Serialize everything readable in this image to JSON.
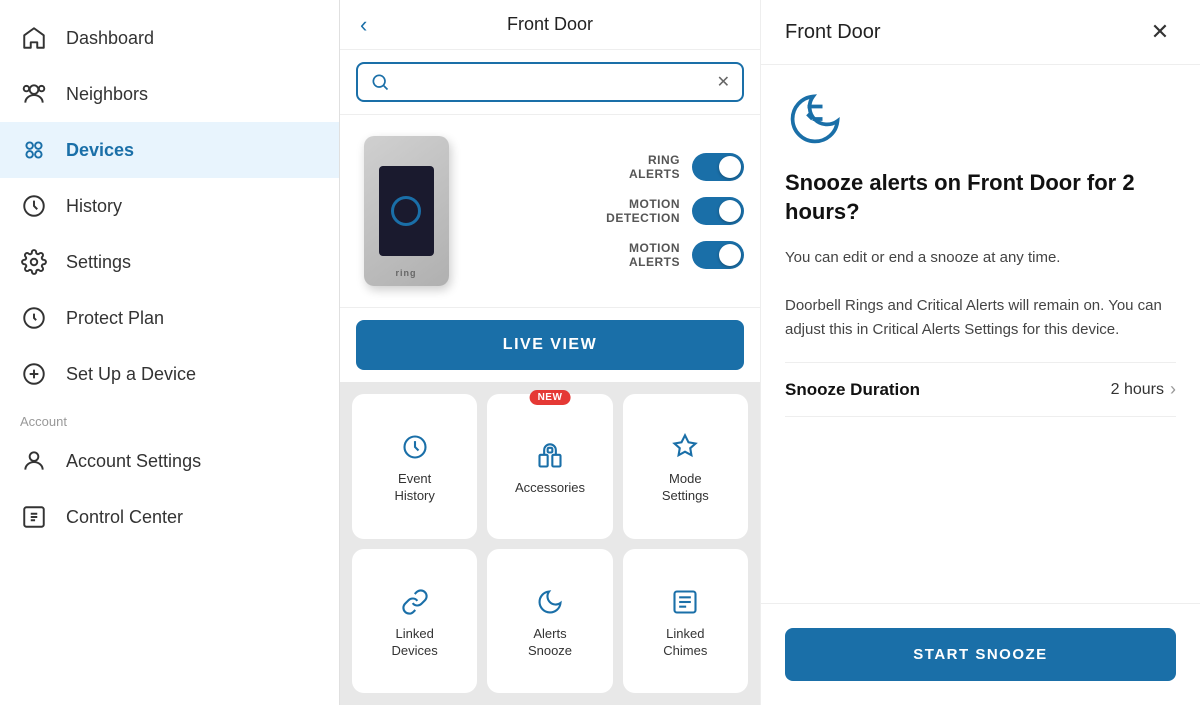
{
  "sidebar": {
    "items": [
      {
        "id": "dashboard",
        "label": "Dashboard",
        "icon": "home"
      },
      {
        "id": "neighbors",
        "label": "Neighbors",
        "icon": "neighbors"
      },
      {
        "id": "devices",
        "label": "Devices",
        "icon": "devices",
        "active": true
      },
      {
        "id": "history",
        "label": "History",
        "icon": "history"
      },
      {
        "id": "settings",
        "label": "Settings",
        "icon": "settings"
      },
      {
        "id": "protect-plan",
        "label": "Protect Plan",
        "icon": "shield"
      },
      {
        "id": "setup",
        "label": "Set Up a Device",
        "icon": "plus"
      }
    ],
    "account_label": "Account",
    "account_items": [
      {
        "id": "account-settings",
        "label": "Account Settings",
        "icon": "user"
      },
      {
        "id": "control-center",
        "label": "Control Center",
        "icon": "control"
      }
    ]
  },
  "device_panel": {
    "title": "Front Door",
    "search_placeholder": "",
    "toggles": [
      {
        "id": "ring-alerts",
        "label": "RING\nALERTS",
        "enabled": true
      },
      {
        "id": "motion-detection",
        "label": "MOTION\nDETECTION",
        "enabled": true
      },
      {
        "id": "motion-alerts",
        "label": "MOTION\nALERTS",
        "enabled": true
      }
    ],
    "live_view_label": "LIVE VIEW",
    "grid_items": [
      {
        "id": "event-history",
        "label": "Event\nHistory",
        "icon": "clock",
        "new": false
      },
      {
        "id": "accessories",
        "label": "Accessories",
        "icon": "accessories",
        "new": true,
        "new_label": "NEW"
      },
      {
        "id": "mode-settings",
        "label": "Mode\nSettings",
        "icon": "shield-grid",
        "new": false
      },
      {
        "id": "linked-devices",
        "label": "Linked\nDevices",
        "icon": "link",
        "new": false
      },
      {
        "id": "alerts-snooze",
        "label": "Alerts\nSnooze",
        "icon": "moon",
        "new": false
      },
      {
        "id": "linked-chimes",
        "label": "Linked\nChimes",
        "icon": "list",
        "new": false
      }
    ]
  },
  "snooze_panel": {
    "title": "Front Door",
    "heading": "Snooze alerts on Front Door for 2 hours?",
    "desc1": "You can edit or end a snooze at any time.",
    "desc2": "Doorbell Rings and Critical Alerts will remain on. You can adjust this in Critical Alerts Settings for this device.",
    "duration_label": "Snooze Duration",
    "duration_value": "2 hours",
    "start_label": "START SNOOZE"
  }
}
